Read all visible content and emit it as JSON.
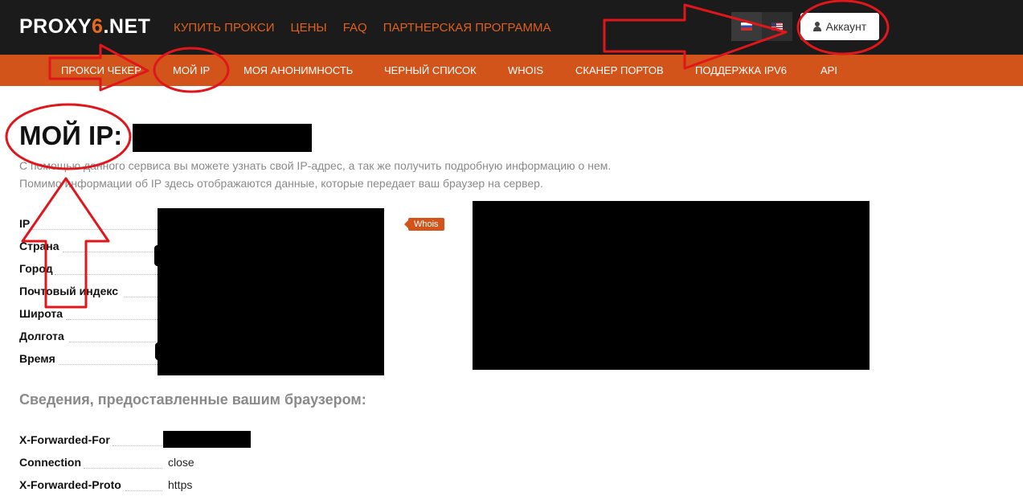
{
  "header": {
    "logo_prefix": "PROXY",
    "logo_six": "6",
    "logo_suffix": ".NET",
    "nav": [
      "КУПИТЬ ПРОКСИ",
      "ЦЕНЫ",
      "FAQ",
      "ПАРТНЕРСКАЯ ПРОГРАММА"
    ],
    "account_label": "Аккаунт"
  },
  "subnav": [
    "ПРОКСИ ЧЕКЕР",
    "МОЙ IP",
    "МОЯ АНОНИМНОСТЬ",
    "ЧЕРНЫЙ СПИСОК",
    "WHOIS",
    "СКАНЕР ПОРТОВ",
    "ПОДДЕРЖКА IPV6",
    "API"
  ],
  "main": {
    "title": "МОЙ IP:",
    "desc_line1": "С помощью данного сервиса вы можете узнать свой IP-адрес, а так же получить подробную информацию о нем.",
    "desc_line2": "Помимо информации об IP здесь отображаются данные, которые передает ваш браузер на сервер.",
    "info_labels": [
      "IP",
      "Страна",
      "Город",
      "Почтовый индекс",
      "Широта",
      "Долгота",
      "Время"
    ],
    "whois_badge": "Whois",
    "browser_section_title": "Сведения, предоставленные вашим браузером:",
    "browser_rows": [
      {
        "label": "X-Forwarded-For",
        "value": ""
      },
      {
        "label": "Connection",
        "value": "close"
      },
      {
        "label": "X-Forwarded-Proto",
        "value": "https"
      }
    ]
  },
  "colors": {
    "accent": "#d2541b",
    "topbar": "#1b1b1b",
    "annotation": "#e0161b"
  }
}
